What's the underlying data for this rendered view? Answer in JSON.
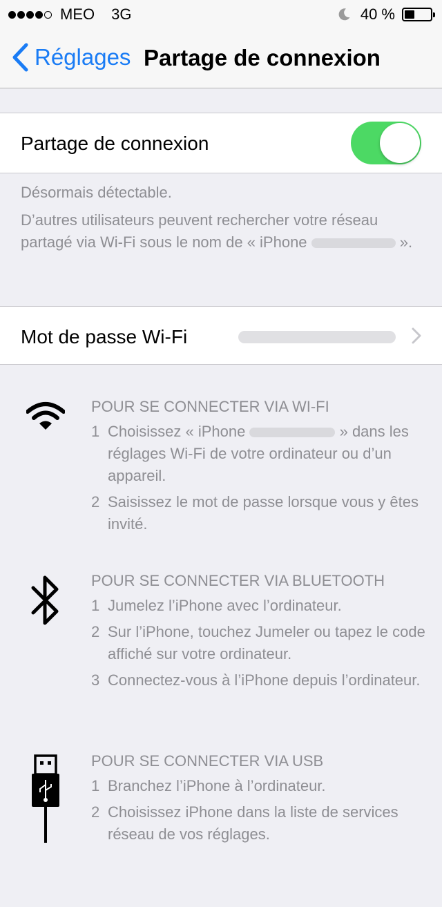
{
  "status_bar": {
    "signal_bars_filled": 4,
    "signal_bars_total": 5,
    "carrier": "MEO",
    "network": "3G",
    "battery_text": "40 %",
    "battery_level": 0.4
  },
  "nav": {
    "back_label": "Réglages",
    "title": "Partage de connexion"
  },
  "hotspot": {
    "label": "Partage de connexion",
    "enabled": true
  },
  "discoverable": {
    "line1": "Désormais détectable.",
    "line2_prefix": "D’autres utilisateurs peuvent rechercher votre réseau partagé via Wi-Fi sous le nom de « iPhone",
    "line2_suffix": "»."
  },
  "wifi_password": {
    "label": "Mot de passe Wi-Fi"
  },
  "instructions": {
    "wifi": {
      "heading": "POUR SE CONNECTER VIA WI-FI",
      "step1_num": "1",
      "step1_prefix": "Choisissez « iPhone",
      "step1_suffix": "» dans les réglages Wi-Fi de votre ordinateur ou d’un appareil.",
      "step2_num": "2",
      "step2": "Saisissez le mot de passe lorsque vous y êtes invité."
    },
    "bluetooth": {
      "heading": "POUR SE CONNECTER VIA BLUETOOTH",
      "steps": [
        {
          "num": "1",
          "text": "Jumelez l’iPhone avec l’ordinateur."
        },
        {
          "num": "2",
          "text": "Sur l’iPhone, touchez Jumeler ou tapez le code affiché sur votre ordinateur."
        },
        {
          "num": "3",
          "text": "Connectez-vous à l’iPhone depuis l’ordinateur."
        }
      ]
    },
    "usb": {
      "heading": "POUR SE CONNECTER VIA USB",
      "steps": [
        {
          "num": "1",
          "text": "Branchez l’iPhone à l’ordinateur."
        },
        {
          "num": "2",
          "text": "Choisissez iPhone dans la liste de services réseau de vos réglages."
        }
      ]
    }
  },
  "icons": {
    "back": "chevron-left-icon",
    "moon": "moon-icon",
    "battery": "battery-icon",
    "chevron": "chevron-right-icon",
    "wifi": "wifi-icon",
    "bluetooth": "bluetooth-icon",
    "usb": "usb-icon"
  },
  "colors": {
    "accent": "#1a7cf5",
    "toggle_on": "#4cd964",
    "background": "#efeff4",
    "secondary_text": "#8e8e93"
  }
}
